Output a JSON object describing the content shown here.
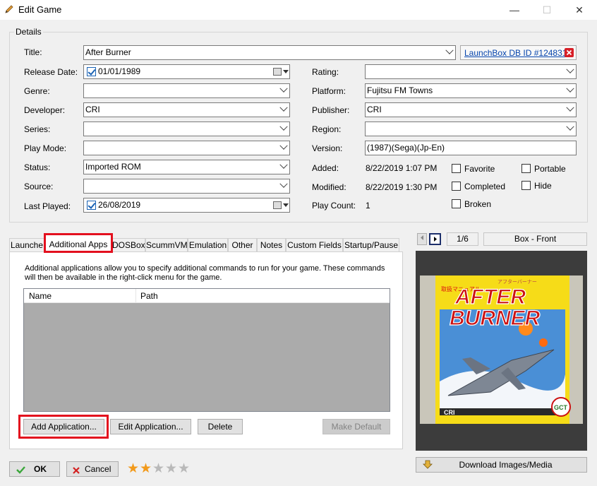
{
  "window": {
    "title": "Edit Game",
    "minimize": "—",
    "maximize": "☐",
    "close": "✕"
  },
  "details": {
    "legend": "Details",
    "title_label": "Title:",
    "title_value": "After Burner",
    "db_link": "LaunchBox DB ID #124831",
    "release_label": "Release Date:",
    "release_value": "01/01/1989",
    "genre_label": "Genre:",
    "genre_value": "",
    "developer_label": "Developer:",
    "developer_value": "CRI",
    "series_label": "Series:",
    "series_value": "",
    "playmode_label": "Play Mode:",
    "playmode_value": "",
    "status_label": "Status:",
    "status_value": "Imported ROM",
    "source_label": "Source:",
    "source_value": "",
    "lastplayed_label": "Last Played:",
    "lastplayed_value": "26/08/2019",
    "rating_label": "Rating:",
    "rating_value": "",
    "platform_label": "Platform:",
    "platform_value": "Fujitsu FM Towns",
    "publisher_label": "Publisher:",
    "publisher_value": "CRI",
    "region_label": "Region:",
    "region_value": "",
    "version_label": "Version:",
    "version_value": "(1987)(Sega)(Jp-En)",
    "added_label": "Added:",
    "added_value": "8/22/2019 1:07 PM",
    "modified_label": "Modified:",
    "modified_value": "8/22/2019 1:30 PM",
    "playcount_label": "Play Count:",
    "playcount_value": "1",
    "favorite_label": "Favorite",
    "portable_label": "Portable",
    "completed_label": "Completed",
    "hide_label": "Hide",
    "broken_label": "Broken"
  },
  "tabs": [
    {
      "label": "Launche"
    },
    {
      "label": "Additional Apps"
    },
    {
      "label": "DOSBox"
    },
    {
      "label": "ScummVM"
    },
    {
      "label": "Emulation"
    },
    {
      "label": "Other"
    },
    {
      "label": "Notes"
    },
    {
      "label": "Custom Fields"
    },
    {
      "label": "Startup/Pause"
    }
  ],
  "panel": {
    "description": "Additional applications allow you to specify additional commands to run for your game.  These commands will then be available in the right-click menu for the game.",
    "col_name": "Name",
    "col_path": "Path",
    "add_button": "Add Application...",
    "edit_button": "Edit Application...",
    "delete_button": "Delete",
    "default_button": "Make Default"
  },
  "media": {
    "page_indicator": "1/6",
    "image_type": "Box - Front",
    "download_button": "Download Images/Media",
    "cover_title_1": "AFTER",
    "cover_title_2": "BURNER",
    "cover_small_1": "アフターバーナー",
    "cover_small_2": "取扱マニュアル",
    "cover_publisher": "CRI",
    "cover_badge": "GCT"
  },
  "footer": {
    "ok_label": "OK",
    "cancel_label": "Cancel",
    "rating_stars": 2,
    "rating_max": 5
  },
  "colors": {
    "highlight": "#e3101e",
    "link": "#0645ad",
    "star_on": "#f29a1b",
    "star_off": "#b9b9b9"
  }
}
